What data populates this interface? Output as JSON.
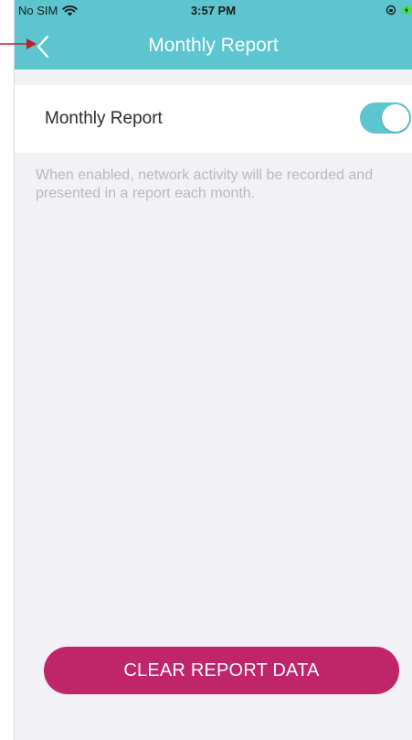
{
  "status_bar": {
    "carrier": "No SIM",
    "time": "3:57 PM",
    "wifi_icon": "wifi-icon",
    "lock_icon": "orientation-lock-icon",
    "battery_icon": "battery-charging-icon"
  },
  "header": {
    "title": "Monthly Report",
    "back_icon": "chevron-left-icon",
    "background_color": "#5cc5cf"
  },
  "setting": {
    "label": "Monthly Report",
    "toggle_on": true,
    "toggle_color": "#5cc5cf"
  },
  "description": "When enabled, network activity will be recorded and presented in a report each month.",
  "actions": {
    "clear_label": "CLEAR REPORT DATA",
    "clear_color": "#c0256a"
  },
  "annotation": {
    "arrow_color": "#c0202a"
  }
}
